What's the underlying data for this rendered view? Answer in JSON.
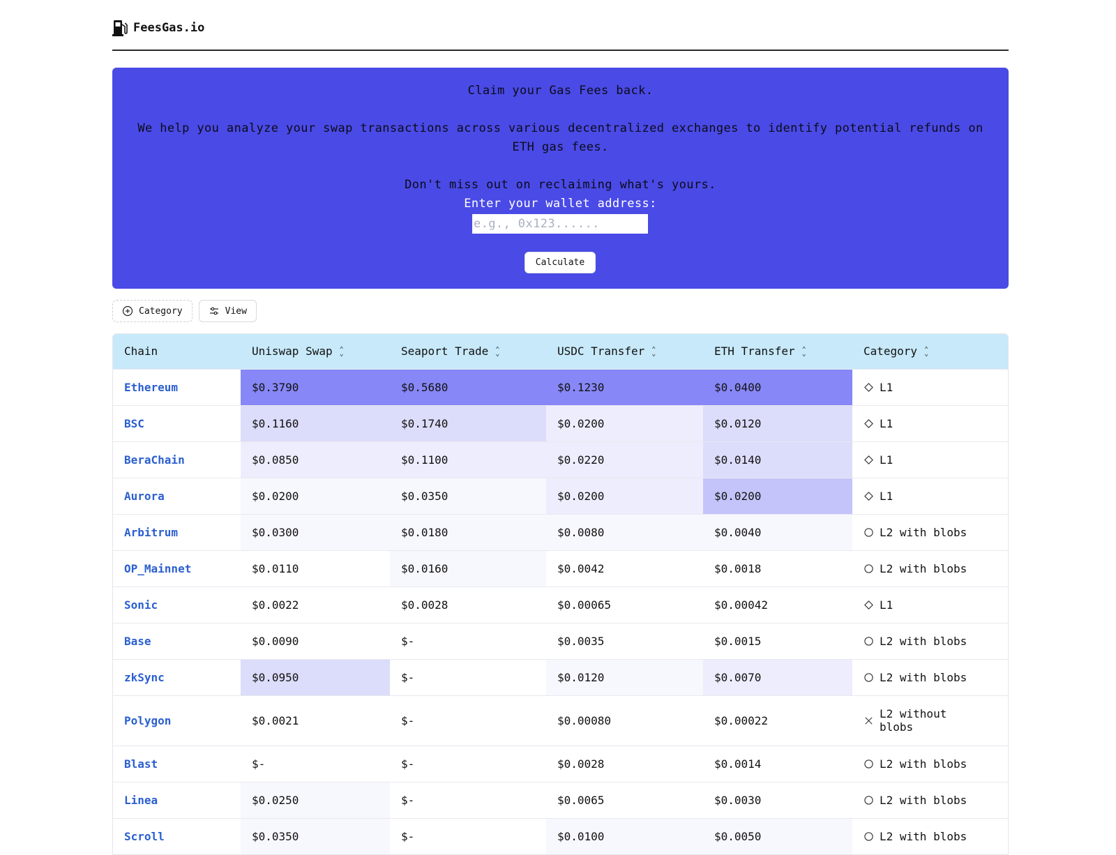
{
  "brand": {
    "name": "FeesGas.io",
    "icon": "fuel-pump-icon"
  },
  "hero": {
    "headline": "Claim your Gas Fees back.",
    "description": "We help you analyze your swap transactions across various decentralized exchanges to identify potential refunds on ETH gas fees.",
    "cta_text": "Don't miss out on reclaiming what's yours.",
    "wallet_label": "Enter your wallet address:",
    "wallet_placeholder": "e.g., 0x123......",
    "wallet_value": "",
    "calculate_label": "Calculate",
    "background": "#4a4ae6"
  },
  "toolbar": {
    "category_label": "Category",
    "category_icon": "plus-circle-icon",
    "view_label": "View",
    "view_icon": "sliders-icon"
  },
  "table": {
    "columns": [
      {
        "label": "Chain",
        "sortable": false
      },
      {
        "label": "Uniswap Swap",
        "sortable": true
      },
      {
        "label": "Seaport Trade",
        "sortable": true
      },
      {
        "label": "USDC Transfer",
        "sortable": true
      },
      {
        "label": "ETH Transfer",
        "sortable": true
      },
      {
        "label": "Category",
        "sortable": true
      }
    ],
    "header_background": "#c7e9f9",
    "rows": [
      {
        "chain": "Ethereum",
        "uniswap": "$0.3790",
        "seaport": "$0.5680",
        "usdc": "$0.1230",
        "eth": "$0.0400",
        "category": "L1",
        "category_icon": "diamond-icon",
        "shades": [
          "#8787f7",
          "#8787f7",
          "#8787f7",
          "#8787f7"
        ]
      },
      {
        "chain": "BSC",
        "uniswap": "$0.1160",
        "seaport": "$0.1740",
        "usdc": "$0.0200",
        "eth": "$0.0120",
        "category": "L1",
        "category_icon": "diamond-icon",
        "shades": [
          "#dcdcfb",
          "#dcdcfb",
          "#ededfd",
          "#dcdcfb"
        ]
      },
      {
        "chain": "BeraChain",
        "uniswap": "$0.0850",
        "seaport": "$0.1100",
        "usdc": "$0.0220",
        "eth": "$0.0140",
        "category": "L1",
        "category_icon": "diamond-icon",
        "shades": [
          "#ededfd",
          "#ededfd",
          "#ededfd",
          "#dcdcfb"
        ]
      },
      {
        "chain": "Aurora",
        "uniswap": "$0.0200",
        "seaport": "$0.0350",
        "usdc": "$0.0200",
        "eth": "$0.0200",
        "category": "L1",
        "category_icon": "diamond-icon",
        "shades": [
          "#f7f7fe",
          "#f7f7fe",
          "#ededfd",
          "#c4c4fa"
        ]
      },
      {
        "chain": "Arbitrum",
        "uniswap": "$0.0300",
        "seaport": "$0.0180",
        "usdc": "$0.0080",
        "eth": "$0.0040",
        "category": "L2 with blobs",
        "category_icon": "circle-icon",
        "shades": [
          "#f7f7fe",
          "#f7f7fe",
          "#f7f7fe",
          "#f7f7fe"
        ]
      },
      {
        "chain": "OP_Mainnet",
        "uniswap": "$0.0110",
        "seaport": "$0.0160",
        "usdc": "$0.0042",
        "eth": "$0.0018",
        "category": "L2 with blobs",
        "category_icon": "circle-icon",
        "shades": [
          "#ffffff",
          "#f7f7fe",
          "#ffffff",
          "#ffffff"
        ]
      },
      {
        "chain": "Sonic",
        "uniswap": "$0.0022",
        "seaport": "$0.0028",
        "usdc": "$0.00065",
        "eth": "$0.00042",
        "category": "L1",
        "category_icon": "diamond-icon",
        "shades": [
          "#ffffff",
          "#ffffff",
          "#ffffff",
          "#ffffff"
        ]
      },
      {
        "chain": "Base",
        "uniswap": "$0.0090",
        "seaport": "$-",
        "usdc": "$0.0035",
        "eth": "$0.0015",
        "category": "L2 with blobs",
        "category_icon": "circle-icon",
        "shades": [
          "#ffffff",
          "#ffffff",
          "#ffffff",
          "#ffffff"
        ]
      },
      {
        "chain": "zkSync",
        "uniswap": "$0.0950",
        "seaport": "$-",
        "usdc": "$0.0120",
        "eth": "$0.0070",
        "category": "L2 with blobs",
        "category_icon": "circle-icon",
        "shades": [
          "#dcdcfb",
          "#ffffff",
          "#f7f7fe",
          "#ededfd"
        ]
      },
      {
        "chain": "Polygon",
        "uniswap": "$0.0021",
        "seaport": "$-",
        "usdc": "$0.00080",
        "eth": "$0.00022",
        "category": "L2 without blobs",
        "category_icon": "x-icon",
        "shades": [
          "#ffffff",
          "#ffffff",
          "#ffffff",
          "#ffffff"
        ]
      },
      {
        "chain": "Blast",
        "uniswap": "$-",
        "seaport": "$-",
        "usdc": "$0.0028",
        "eth": "$0.0014",
        "category": "L2 with blobs",
        "category_icon": "circle-icon",
        "shades": [
          "#ffffff",
          "#ffffff",
          "#ffffff",
          "#ffffff"
        ]
      },
      {
        "chain": "Linea",
        "uniswap": "$0.0250",
        "seaport": "$-",
        "usdc": "$0.0065",
        "eth": "$0.0030",
        "category": "L2 with blobs",
        "category_icon": "circle-icon",
        "shades": [
          "#f7f7fe",
          "#ffffff",
          "#ffffff",
          "#ffffff"
        ]
      },
      {
        "chain": "Scroll",
        "uniswap": "$0.0350",
        "seaport": "$-",
        "usdc": "$0.0100",
        "eth": "$0.0050",
        "category": "L2 with blobs",
        "category_icon": "circle-icon",
        "shades": [
          "#f7f7fe",
          "#ffffff",
          "#f7f7fe",
          "#f7f7fe"
        ]
      }
    ]
  }
}
